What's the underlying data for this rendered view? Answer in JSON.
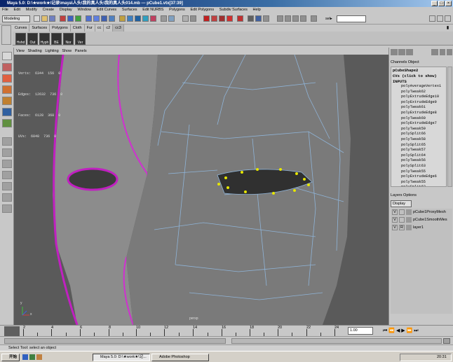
{
  "window": {
    "title": "Maya 5.0: D:\\★work★\\记录\\maya\\人头\\我的真人头\\我的真人头014.mb  ---  pCube1.vtx[37:39]"
  },
  "menubar": [
    "File",
    "Edit",
    "Modify",
    "Create",
    "Display",
    "Window",
    "Edit Curves",
    "Surfaces",
    "Edit NURBS",
    "Polygons",
    "Edit Polygons",
    "Subdiv Surfaces",
    "Help"
  ],
  "statusline": {
    "mode": "Modeling",
    "selection_label": "sel▸"
  },
  "shelf": {
    "tabs": [
      "Curves",
      "Surfaces",
      "Polygons",
      "Cloth",
      "Fur",
      "cc",
      "c2",
      "cc3"
    ],
    "buttons": [
      "Hshd",
      "Out",
      "Hyph",
      "BE",
      "Nor",
      "Ver"
    ]
  },
  "panel_menu": [
    "View",
    "Shading",
    "Lighting",
    "Show",
    "Panels"
  ],
  "hud": [
    {
      "label": "Verts:",
      "a": "6344",
      "b": "156",
      "c": "0"
    },
    {
      "label": "Edges:",
      "a": "12632",
      "b": "736",
      "c": "0"
    },
    {
      "label": "Faces:",
      "a": "6128",
      "b": "368",
      "c": "0"
    },
    {
      "label": "UVs:",
      "a": "6848",
      "b": "736",
      "c": "0"
    }
  ],
  "viewport": {
    "axis_x": "x",
    "axis_y": "y",
    "camera": "persp"
  },
  "channelbox": {
    "menus": [
      "Channels",
      "Object"
    ],
    "object_name": "pCubeShape2",
    "cvs_hint": "CVs (click to show)",
    "inputs_label": "INPUTS",
    "inputs": [
      "polyAverageVertex1",
      "polyTweak62",
      "polyExtrudeEdge10",
      "polyExtrudeEdge9",
      "polyTweak61",
      "polyExtrudeEdge8",
      "polyTweak60",
      "polyExtrudeEdge7",
      "polyTweak59",
      "polySplit66",
      "polyTweak58",
      "polySplit65",
      "polyTweak57",
      "polySplit64",
      "polyTweak56",
      "polySplit63",
      "polyTweak55",
      "polyExtrudeEdge6",
      "polyTweak55",
      "polySplit62",
      "polyTweak54"
    ]
  },
  "layers": {
    "menus": [
      "Layers",
      "Options"
    ],
    "display_label": "Display",
    "items": [
      {
        "v": "V",
        "t": "",
        "name": "pCube1ProxyMesh"
      },
      {
        "v": "V",
        "t": "",
        "name": "pCube1SmoothMes"
      },
      {
        "v": "V",
        "t": "R",
        "name": "layer1"
      }
    ]
  },
  "timeline": {
    "ticks": [
      "2",
      "4",
      "6",
      "8",
      "10",
      "12",
      "14",
      "16",
      "18",
      "20",
      "22",
      "24"
    ],
    "current_frame": "1.00"
  },
  "help_line": "Select Tool: select an object",
  "taskbar": {
    "start": "开始",
    "tasks": [
      "Maya 5.0: D:\\★work★\\记...",
      "Adobe Photoshop"
    ],
    "clock": "20:31"
  }
}
